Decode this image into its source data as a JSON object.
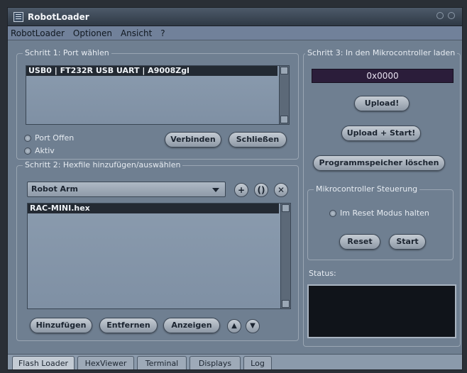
{
  "window": {
    "title": "RobotLoader"
  },
  "menu": [
    "RobotLoader",
    "Optionen",
    "Ansicht",
    "?"
  ],
  "step1": {
    "title": "Schritt 1: Port wählen",
    "port_selected": "USB0 | FT232R USB UART | A9008Zgl",
    "radio_open": "Port Offen",
    "radio_active": "Aktiv",
    "connect_label": "Verbinden",
    "close_label": "Schließen"
  },
  "step2": {
    "title": "Schritt 2: Hexfile hinzufügen/auswählen",
    "dropdown_value": "Robot Arm",
    "file_selected": "RAC-MINI.hex",
    "add_label": "Hinzufügen",
    "remove_label": "Entfernen",
    "show_label": "Anzeigen"
  },
  "step3": {
    "title": "Schritt 3: In den Mikrocontroller laden",
    "address": "0x0000",
    "upload_label": "Upload!",
    "upload_start_label": "Upload + Start!",
    "erase_label": "Programmspeicher löschen"
  },
  "mcu": {
    "title": "Mikrocontroller Steuerung",
    "reset_mode_label": "Im Reset Modus halten",
    "reset_label": "Reset",
    "start_label": "Start"
  },
  "status": {
    "label": "Status:"
  },
  "tabs": [
    "Flash Loader",
    "HexViewer",
    "Terminal",
    "Displays",
    "Log"
  ],
  "icons": {
    "add": "+",
    "up_arrow": "▲",
    "down_arrow": "▼"
  }
}
